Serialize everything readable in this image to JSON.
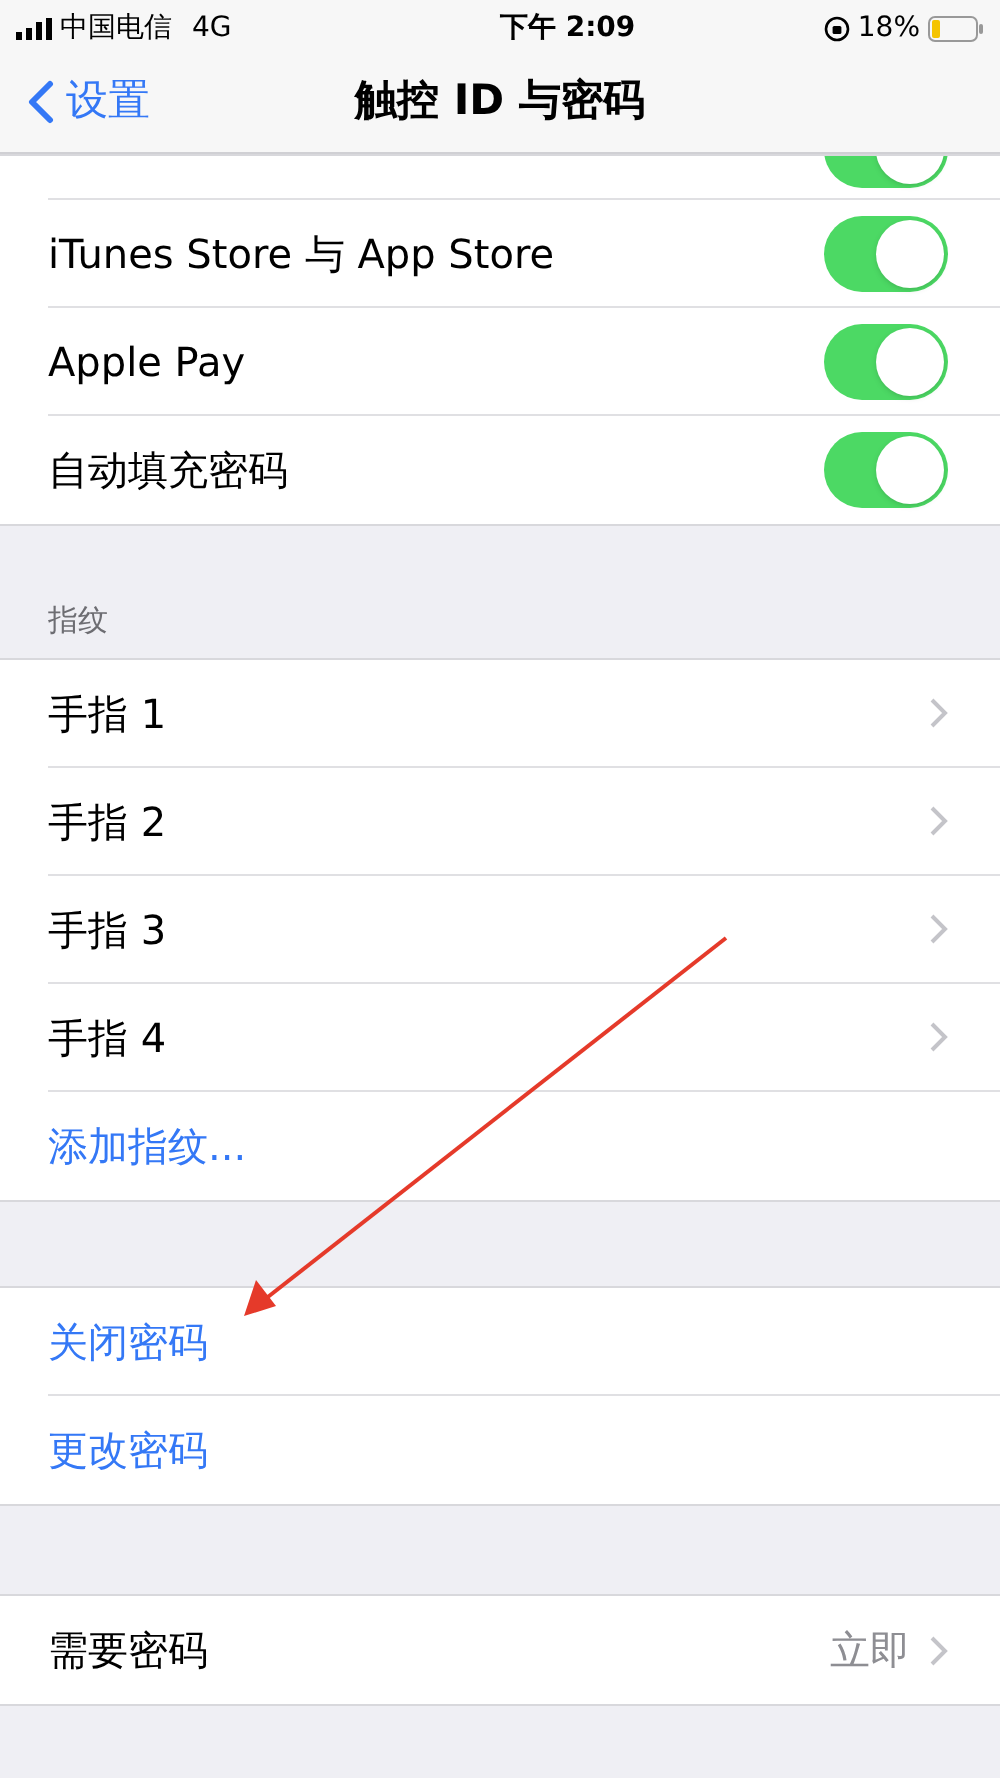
{
  "status_bar": {
    "carrier": "中国电信",
    "network": "4G",
    "time": "下午 2:09",
    "battery": "18%"
  },
  "nav": {
    "back": "设置",
    "title": "触控 ID 与密码"
  },
  "sections": [
    {
      "rows": [
        {
          "kind": "clipped-toggle",
          "on": true
        },
        {
          "kind": "toggle",
          "label": "iTunes Store 与 App Store",
          "on": true
        },
        {
          "kind": "toggle",
          "label": "Apple Pay",
          "on": true
        },
        {
          "kind": "toggle",
          "label": "自动填充密码",
          "on": true
        }
      ]
    },
    {
      "header": "指纹",
      "rows": [
        {
          "kind": "disclosure",
          "label": "手指 1"
        },
        {
          "kind": "disclosure",
          "label": "手指 2"
        },
        {
          "kind": "disclosure",
          "label": "手指 3"
        },
        {
          "kind": "disclosure",
          "label": "手指 4"
        },
        {
          "kind": "link",
          "label": "添加指纹..."
        }
      ]
    },
    {
      "rows": [
        {
          "kind": "link",
          "label": "关闭密码"
        },
        {
          "kind": "link",
          "label": "更改密码"
        }
      ]
    },
    {
      "rows": [
        {
          "kind": "value",
          "label": "需要密码",
          "value": "立即"
        }
      ]
    }
  ]
}
